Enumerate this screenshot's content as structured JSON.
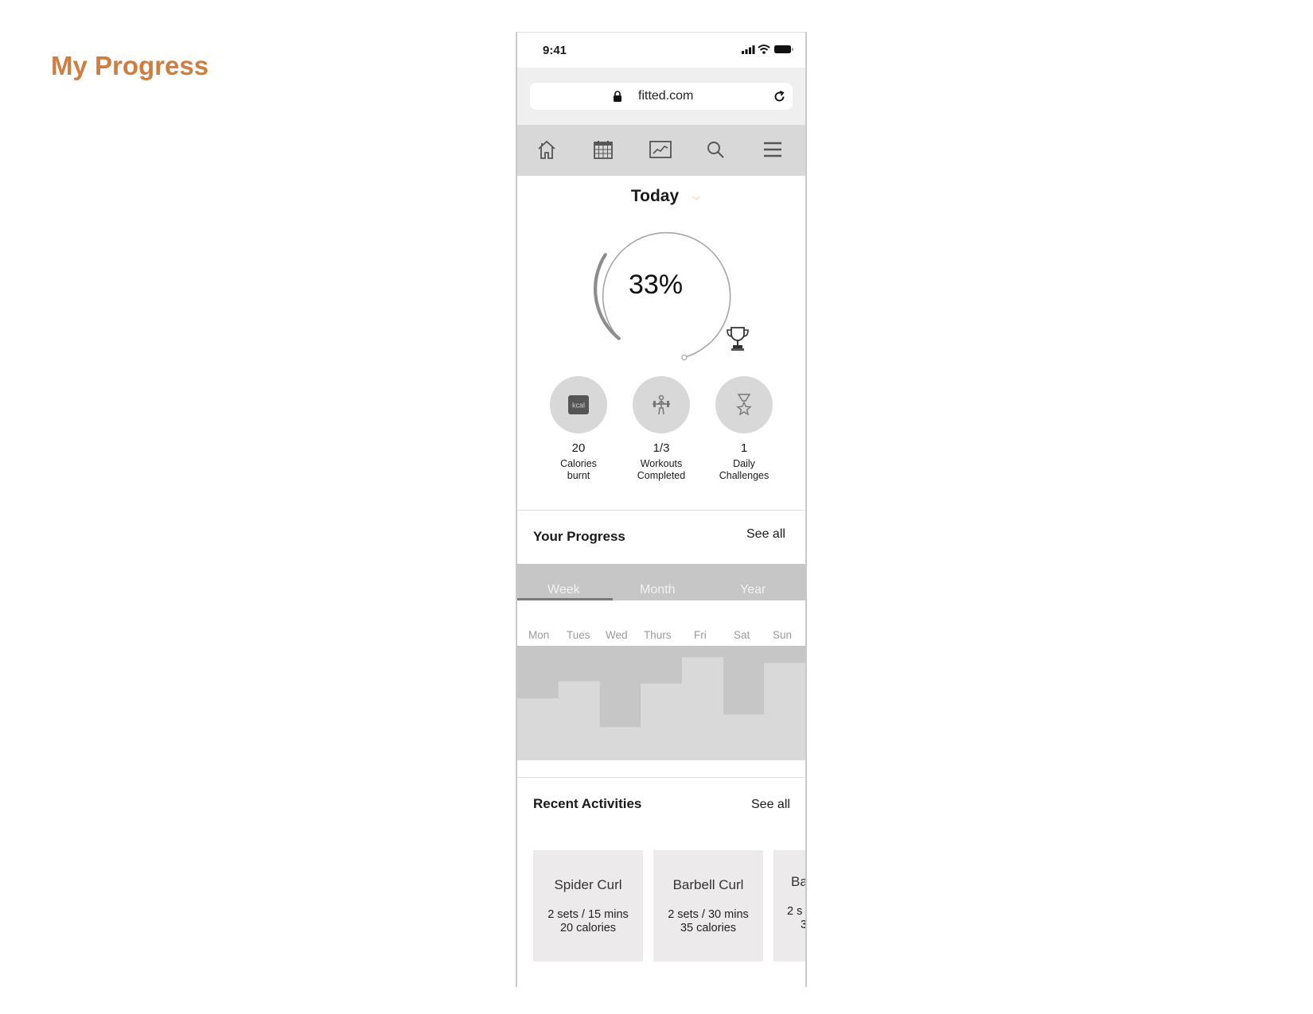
{
  "page": {
    "heading": "My Progress"
  },
  "status_bar": {
    "time": "9:41",
    "icons": [
      "signal-icon",
      "wifi-icon",
      "battery-icon"
    ]
  },
  "browser": {
    "url": "fitted.com",
    "icons": [
      "lock-icon",
      "reload-icon"
    ]
  },
  "nav": {
    "items": [
      "home-icon",
      "calendar-icon",
      "trend-chart-icon",
      "search-icon",
      "menu-icon"
    ]
  },
  "period": {
    "label": "Today"
  },
  "progress": {
    "percent_text": "33%",
    "fraction": 0.33
  },
  "stats": [
    {
      "value": "20",
      "label_line1": "Calories",
      "label_line2": "burnt",
      "icon": "kcal-icon",
      "icon_text": "kcal"
    },
    {
      "value": "1/3",
      "label_line1": "Workouts",
      "label_line2": "Completed",
      "icon": "weightlifter-icon"
    },
    {
      "value": "1",
      "label_line1": "Daily",
      "label_line2": "Challenges",
      "icon": "medal-icon"
    }
  ],
  "your_progress": {
    "title": "Your Progress",
    "see_all": "See all",
    "tabs": [
      "Week",
      "Month",
      "Year"
    ],
    "active_tab": "Week",
    "days": [
      "Mon",
      "Tues",
      "Wed",
      "Thurs",
      "Fri",
      "Sat",
      "Sun"
    ],
    "day_levels": [
      0.54,
      0.69,
      0.29,
      0.67,
      0.9,
      0.4,
      0.85
    ]
  },
  "recent_activities": {
    "title": "Recent Activities",
    "see_all": "See all",
    "cards": [
      {
        "name": "Spider Curl",
        "detail": "2 sets / 15 mins",
        "calories": "20 calories"
      },
      {
        "name": "Barbell Curl",
        "detail": "2 sets / 30 mins",
        "calories": "35 calories"
      },
      {
        "name": "Ba",
        "detail": "2 s",
        "calories": "3"
      }
    ]
  },
  "colors": {
    "heading": "#d07d3e",
    "nav_bg": "#d8d8d8",
    "card_bg": "#eceaea",
    "chart_bg": "#c6c6c6",
    "chart_bar": "#d9d9d9"
  }
}
